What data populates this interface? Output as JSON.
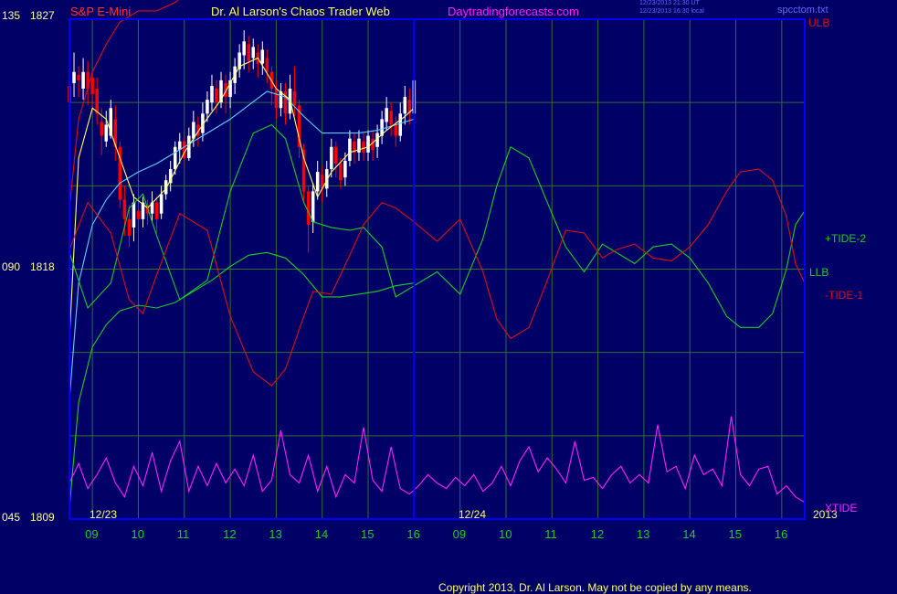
{
  "header": {
    "symbol": "S&P E-Mini",
    "title": "Dr. Al Larson's Chaos Trader Web",
    "site": "Daytradingforecasts.com",
    "stamp_line1": "12/23/2013 21:30 UT",
    "stamp_line2": "12/23/2013 16:30 local",
    "file": "spcctom.txt"
  },
  "footer": {
    "copyright": "Copyright 2013, Dr. Al Larson. May not be copied by any means."
  },
  "colors": {
    "background": "#000066",
    "frame": "#0000ff",
    "grid": "#2f6f2f",
    "price_bull": "#ffffff",
    "price_bear": "#ff0000",
    "ma_fast": "#ffff66",
    "ma_slow": "#66ccff",
    "tide_plus": "#22cc22",
    "tide_minus": "#dd1111",
    "xtide": "#ff22ff",
    "left_scale_text": "#ffff99",
    "day_label_text": "#ffff66",
    "hour_label_text": "#22cc22",
    "copyright_text": "#ffff66"
  },
  "chart_data": {
    "type": "line",
    "title": "Dr. Al Larson's Chaos Trader Web",
    "y_scale_labels": [
      {
        "index": "135",
        "price": "1827",
        "value": 1827
      },
      {
        "index": "090",
        "price": "1818",
        "value": 1818
      },
      {
        "index": "045",
        "price": "1809",
        "value": 1809
      }
    ],
    "ylim": [
      1809,
      1827
    ],
    "x_hour_ticks": [
      "09",
      "10",
      "11",
      "12",
      "13",
      "14",
      "15",
      "16",
      "09",
      "10",
      "11",
      "12",
      "13",
      "14",
      "15",
      "16"
    ],
    "day_labels": [
      "12/23",
      "12/24"
    ],
    "year_label": "2013",
    "xlim": [
      8.5,
      24.5
    ],
    "right_labels": {
      "ulb": "ULB",
      "llb": "LLB",
      "tide_plus": "+TIDE-2",
      "tide_minus": "-TIDE-1",
      "xtide": "XTIDE"
    },
    "price_bars": [
      [
        8.5,
        1824.6,
        1824.0,
        1825.4,
        1823.6
      ],
      [
        8.6,
        1824.7,
        1825.1,
        1825.8,
        1824.2
      ],
      [
        8.7,
        1825.0,
        1824.8,
        1825.3,
        1824.2
      ],
      [
        8.8,
        1824.5,
        1825.1,
        1825.6,
        1824.1
      ],
      [
        8.9,
        1825.1,
        1824.5,
        1825.5,
        1823.9
      ],
      [
        9.0,
        1824.9,
        1824.3,
        1825.1,
        1823.6
      ],
      [
        9.1,
        1824.5,
        1823.6,
        1824.9,
        1823.2
      ],
      [
        9.2,
        1823.3,
        1822.8,
        1823.8,
        1822.1
      ],
      [
        9.3,
        1822.6,
        1823.2,
        1823.7,
        1822.4
      ],
      [
        9.4,
        1822.8,
        1823.8,
        1824.1,
        1822.7
      ],
      [
        9.5,
        1823.4,
        1822.4,
        1823.9,
        1821.9
      ],
      [
        9.6,
        1822.4,
        1820.5,
        1822.6,
        1820.2
      ],
      [
        9.7,
        1820.5,
        1819.8,
        1821.0,
        1819.2
      ],
      [
        9.8,
        1819.8,
        1819.2,
        1820.3,
        1818.8
      ],
      [
        9.9,
        1819.5,
        1820.4,
        1820.7,
        1819.0
      ],
      [
        10.0,
        1820.1,
        1819.8,
        1820.4,
        1819.4
      ],
      [
        10.1,
        1819.8,
        1820.4,
        1820.6,
        1819.5
      ],
      [
        10.2,
        1820.3,
        1820.0,
        1820.5,
        1819.6
      ],
      [
        10.3,
        1820.0,
        1820.4,
        1820.8,
        1819.7
      ],
      [
        10.4,
        1820.4,
        1819.8,
        1820.6,
        1819.3
      ],
      [
        10.5,
        1820.0,
        1820.7,
        1821.0,
        1819.8
      ],
      [
        10.6,
        1820.7,
        1821.2,
        1821.4,
        1820.5
      ],
      [
        10.7,
        1821.1,
        1821.6,
        1821.9,
        1820.8
      ],
      [
        10.8,
        1821.6,
        1822.4,
        1822.6,
        1821.4
      ],
      [
        10.9,
        1822.3,
        1822.6,
        1822.9,
        1821.8
      ],
      [
        11.0,
        1822.6,
        1822.0,
        1822.8,
        1821.7
      ],
      [
        11.1,
        1822.0,
        1822.8,
        1823.1,
        1821.9
      ],
      [
        11.2,
        1822.7,
        1823.3,
        1823.7,
        1822.4
      ],
      [
        11.3,
        1823.2,
        1822.8,
        1823.5,
        1822.4
      ],
      [
        11.4,
        1822.9,
        1823.6,
        1824.0,
        1822.6
      ],
      [
        11.5,
        1823.6,
        1824.1,
        1824.4,
        1823.3
      ],
      [
        11.6,
        1824.0,
        1824.6,
        1825.0,
        1823.7
      ],
      [
        11.7,
        1824.5,
        1824.0,
        1824.8,
        1823.6
      ],
      [
        11.8,
        1824.0,
        1824.8,
        1825.1,
        1823.8
      ],
      [
        11.9,
        1824.7,
        1824.2,
        1825.0,
        1823.6
      ],
      [
        12.0,
        1824.2,
        1824.8,
        1825.1,
        1823.8
      ],
      [
        12.1,
        1824.7,
        1825.3,
        1825.6,
        1824.3
      ],
      [
        12.2,
        1825.2,
        1825.8,
        1826.1,
        1824.9
      ],
      [
        12.3,
        1825.7,
        1826.2,
        1826.6,
        1825.2
      ],
      [
        12.4,
        1826.1,
        1825.5,
        1826.4,
        1825.1
      ],
      [
        12.5,
        1825.6,
        1826.0,
        1826.3,
        1825.2
      ],
      [
        12.6,
        1825.8,
        1825.4,
        1826.1,
        1824.9
      ],
      [
        12.7,
        1825.4,
        1825.9,
        1826.2,
        1825.0
      ],
      [
        12.8,
        1825.6,
        1825.1,
        1825.9,
        1824.7
      ],
      [
        12.9,
        1825.1,
        1824.5,
        1825.3,
        1823.9
      ],
      [
        13.0,
        1824.5,
        1823.8,
        1824.8,
        1823.4
      ],
      [
        13.1,
        1823.8,
        1824.4,
        1824.7,
        1823.5
      ],
      [
        13.2,
        1824.4,
        1823.6,
        1824.7,
        1823.2
      ],
      [
        13.3,
        1823.6,
        1824.5,
        1825.0,
        1823.4
      ],
      [
        13.4,
        1824.4,
        1823.9,
        1825.3,
        1823.5
      ],
      [
        13.5,
        1823.9,
        1822.4,
        1824.1,
        1822.0
      ],
      [
        13.6,
        1822.3,
        1820.8,
        1822.5,
        1820.4
      ],
      [
        13.7,
        1820.8,
        1819.6,
        1821.0,
        1818.6
      ],
      [
        13.8,
        1819.7,
        1820.8,
        1821.1,
        1819.3
      ],
      [
        13.9,
        1820.8,
        1821.5,
        1821.9,
        1820.5
      ],
      [
        14.0,
        1821.4,
        1820.9,
        1821.7,
        1820.4
      ],
      [
        14.1,
        1820.9,
        1821.6,
        1821.9,
        1820.6
      ],
      [
        14.2,
        1821.6,
        1822.4,
        1822.7,
        1821.3
      ],
      [
        14.3,
        1822.4,
        1821.8,
        1822.6,
        1821.3
      ],
      [
        14.4,
        1821.8,
        1821.2,
        1822.0,
        1820.9
      ],
      [
        14.5,
        1821.3,
        1821.9,
        1822.2,
        1821.0
      ],
      [
        14.6,
        1821.9,
        1822.7,
        1823.0,
        1821.7
      ],
      [
        14.7,
        1822.6,
        1822.2,
        1822.9,
        1821.8
      ],
      [
        14.8,
        1822.2,
        1822.7,
        1823.0,
        1821.9
      ],
      [
        14.9,
        1822.6,
        1822.2,
        1822.9,
        1821.9
      ],
      [
        15.0,
        1822.2,
        1822.8,
        1823.0,
        1821.9
      ],
      [
        15.1,
        1822.7,
        1822.3,
        1823.0,
        1821.9
      ],
      [
        15.2,
        1822.4,
        1822.9,
        1823.2,
        1822.0
      ],
      [
        15.3,
        1822.8,
        1823.4,
        1823.7,
        1822.5
      ],
      [
        15.4,
        1823.3,
        1823.8,
        1824.2,
        1823.0
      ],
      [
        15.5,
        1823.7,
        1823.2,
        1824.0,
        1822.8
      ],
      [
        15.6,
        1823.2,
        1822.8,
        1823.5,
        1822.4
      ],
      [
        15.7,
        1822.8,
        1823.6,
        1824.0,
        1822.6
      ],
      [
        15.8,
        1823.6,
        1824.2,
        1824.6,
        1823.2
      ],
      [
        15.9,
        1824.1,
        1823.6,
        1824.5,
        1823.2
      ],
      [
        16.0,
        1823.6,
        1824.8,
        1825.1,
        1823.4
      ]
    ],
    "series": [
      {
        "name": "ULB",
        "color": "#dd1111",
        "x": [
          8.5,
          8.7,
          9.0,
          9.3,
          9.6,
          10.0,
          10.4,
          10.8,
          11.2,
          11.6,
          12.0,
          12.4,
          12.8,
          13.2,
          13.6,
          14.0,
          14.4,
          14.8,
          15.2,
          15.6,
          16.0
        ],
        "y": [
          1820.2,
          1823.4,
          1825.1,
          1826.1,
          1826.9,
          1827.3,
          1827.3,
          1827.6,
          1828.2,
          1828.8,
          1829.4,
          1829.6,
          1829.7,
          1829.7,
          1829.3,
          1828.8,
          1828.7,
          1828.8,
          1828.8,
          1828.9,
          1829.0
        ]
      },
      {
        "name": "LLB",
        "color": "#22cc22",
        "x": [
          8.5,
          8.7,
          9.0,
          9.3,
          9.6,
          10.0,
          10.4,
          10.8,
          11.2,
          11.6,
          12.0,
          12.4,
          12.8,
          13.2,
          13.6,
          14.0,
          14.4,
          14.8,
          15.2,
          15.6,
          16.0
        ],
        "y": [
          1809.4,
          1813.2,
          1815.2,
          1816.0,
          1816.5,
          1816.7,
          1816.6,
          1816.8,
          1817.2,
          1817.6,
          1818.1,
          1818.5,
          1818.6,
          1818.4,
          1817.8,
          1817.0,
          1817.0,
          1817.1,
          1817.2,
          1817.4,
          1817.5
        ]
      },
      {
        "name": "MA fast",
        "color": "#ffff66",
        "x": [
          8.5,
          8.7,
          9.0,
          9.3,
          9.6,
          9.9,
          10.2,
          10.6,
          11.0,
          11.4,
          11.8,
          12.2,
          12.6,
          13.0,
          13.3,
          13.6,
          13.9,
          14.2,
          14.6,
          15.0,
          15.4,
          15.8,
          16.0
        ],
        "y": [
          1815.5,
          1822.0,
          1823.8,
          1823.4,
          1822.0,
          1820.6,
          1820.2,
          1820.9,
          1822.2,
          1823.2,
          1824.1,
          1825.3,
          1825.6,
          1824.5,
          1824.1,
          1822.0,
          1820.6,
          1821.5,
          1822.2,
          1822.4,
          1823.0,
          1823.5,
          1823.8
        ]
      },
      {
        "name": "MA slow",
        "color": "#66ccff",
        "x": [
          8.5,
          8.7,
          9.0,
          9.3,
          9.6,
          10.0,
          10.4,
          10.8,
          11.2,
          11.6,
          12.0,
          12.4,
          12.8,
          13.2,
          13.6,
          14.0,
          14.4,
          14.8,
          15.2,
          15.6,
          16.0
        ],
        "y": [
          1813.3,
          1817.5,
          1819.6,
          1820.5,
          1821.1,
          1821.5,
          1821.8,
          1822.2,
          1822.6,
          1823.0,
          1823.4,
          1823.9,
          1824.4,
          1824.2,
          1823.5,
          1822.9,
          1822.9,
          1822.9,
          1823.0,
          1823.2,
          1823.4
        ]
      },
      {
        "name": "+TIDE-2",
        "color": "#22cc22",
        "x": [
          8.5,
          8.9,
          9.4,
          9.8,
          10.1,
          10.4,
          10.9,
          11.5,
          12.0,
          12.5,
          12.9,
          13.2,
          13.6,
          13.8,
          14.2,
          14.6,
          14.9,
          15.3,
          15.6,
          16.0,
          16.5,
          17.0,
          17.5,
          17.8,
          18.1,
          18.5,
          18.9,
          19.3,
          19.7,
          20.1,
          20.4,
          20.8,
          21.2,
          21.6,
          22.0,
          22.4,
          22.8,
          23.1,
          23.5,
          23.8,
          24.1,
          24.3,
          24.5
        ],
        "y": [
          1818.6,
          1816.6,
          1817.5,
          1820.2,
          1820.7,
          1819.2,
          1816.9,
          1817.6,
          1820.8,
          1822.9,
          1823.2,
          1822.7,
          1820.4,
          1819.7,
          1819.5,
          1819.4,
          1819.5,
          1818.8,
          1817.0,
          1817.4,
          1817.9,
          1817.1,
          1819.1,
          1821.0,
          1822.4,
          1822.0,
          1820.4,
          1818.8,
          1817.9,
          1818.9,
          1818.6,
          1818.2,
          1818.8,
          1818.9,
          1818.4,
          1817.5,
          1816.3,
          1815.9,
          1815.9,
          1816.4,
          1818.0,
          1819.6,
          1820.1
        ]
      },
      {
        "name": "-TIDE-1",
        "color": "#dd1111",
        "x": [
          8.5,
          8.9,
          9.4,
          9.8,
          10.1,
          10.4,
          10.9,
          11.5,
          12.0,
          12.5,
          12.9,
          13.2,
          13.6,
          13.8,
          14.2,
          14.6,
          14.9,
          15.3,
          15.6,
          16.0,
          16.5,
          17.0,
          17.5,
          17.8,
          18.1,
          18.5,
          18.9,
          19.3,
          19.7,
          20.1,
          20.4,
          20.8,
          21.2,
          21.6,
          22.0,
          22.4,
          22.8,
          23.1,
          23.5,
          23.8,
          24.1,
          24.3,
          24.5
        ],
        "y": [
          1818.7,
          1820.4,
          1819.3,
          1816.9,
          1816.4,
          1817.8,
          1820.0,
          1819.4,
          1816.3,
          1814.3,
          1813.8,
          1814.4,
          1816.3,
          1817.2,
          1817.1,
          1818.5,
          1819.6,
          1820.4,
          1820.2,
          1819.7,
          1819.0,
          1819.8,
          1817.9,
          1816.2,
          1815.5,
          1815.9,
          1817.6,
          1819.4,
          1819.3,
          1818.4,
          1818.7,
          1818.9,
          1818.4,
          1818.3,
          1818.8,
          1819.6,
          1820.8,
          1821.5,
          1821.6,
          1821.2,
          1819.9,
          1818.2,
          1817.5
        ]
      },
      {
        "name": "XTIDE",
        "color": "#ff22ff",
        "x": [
          8.5,
          8.7,
          8.9,
          9.1,
          9.3,
          9.5,
          9.7,
          9.9,
          10.1,
          10.3,
          10.5,
          10.7,
          10.9,
          11.1,
          11.3,
          11.5,
          11.7,
          11.9,
          12.1,
          12.3,
          12.5,
          12.7,
          12.9,
          13.1,
          13.3,
          13.5,
          13.7,
          13.9,
          14.1,
          14.3,
          14.5,
          14.7,
          14.9,
          15.1,
          15.3,
          15.5,
          15.7,
          15.9,
          16.1,
          16.3,
          16.5,
          16.7,
          16.9,
          17.1,
          17.3,
          17.5,
          17.7,
          17.9,
          18.1,
          18.3,
          18.5,
          18.7,
          18.9,
          19.1,
          19.3,
          19.5,
          19.7,
          19.9,
          20.1,
          20.3,
          20.5,
          20.7,
          20.9,
          21.1,
          21.3,
          21.5,
          21.7,
          21.9,
          22.1,
          22.3,
          22.5,
          22.7,
          22.9,
          23.1,
          23.3,
          23.5,
          23.7,
          23.9,
          24.1,
          24.3,
          24.5
        ],
        "y": [
          1810.3,
          1811.0,
          1810.1,
          1810.6,
          1811.2,
          1810.3,
          1809.8,
          1810.9,
          1810.2,
          1811.4,
          1810.0,
          1811.1,
          1811.8,
          1810.0,
          1810.9,
          1810.2,
          1811.0,
          1810.3,
          1810.8,
          1810.2,
          1811.3,
          1810.0,
          1810.4,
          1812.2,
          1810.6,
          1810.3,
          1811.3,
          1810.0,
          1810.9,
          1809.8,
          1810.6,
          1810.3,
          1812.3,
          1810.4,
          1810.0,
          1811.6,
          1810.1,
          1809.9,
          1810.2,
          1810.6,
          1810.3,
          1810.1,
          1810.5,
          1810.2,
          1810.6,
          1810.0,
          1810.3,
          1810.9,
          1810.2,
          1811.1,
          1811.6,
          1810.7,
          1811.2,
          1810.8,
          1810.3,
          1811.8,
          1810.4,
          1810.5,
          1810.1,
          1810.6,
          1810.9,
          1810.3,
          1810.6,
          1810.3,
          1812.4,
          1810.7,
          1810.9,
          1810.1,
          1811.3,
          1810.6,
          1810.8,
          1810.2,
          1812.7,
          1810.6,
          1810.2,
          1810.8,
          1810.9,
          1809.9,
          1810.2,
          1809.8,
          1809.6
        ]
      }
    ]
  }
}
